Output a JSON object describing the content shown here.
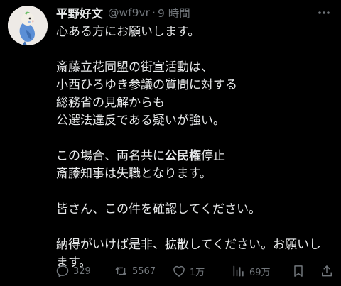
{
  "author": {
    "display_name": "平野好文",
    "handle": "@wf9vr",
    "separator": "·",
    "time_ago": "9 時間"
  },
  "tweet": {
    "lines": {
      "l0": "心ある方にお願いします。",
      "l1": "斎藤立花同盟の街宣活動は、",
      "l2": "小西ひろゆき参議の質問に対する",
      "l3": "総務省の見解からも",
      "l4": "公選法違反である疑いが強い。",
      "l5_pre": "この場合、両名共に",
      "l5_bold": "公民権",
      "l5_post": "停止",
      "l6": "斎藤知事は失職となります。",
      "l7": "皆さん、この件を確認してください。",
      "l8": "納得がいけば是非、拡散してください。お願いし",
      "l9": "ます。"
    }
  },
  "actions": {
    "reply_count": "329",
    "retweet_count": "5567",
    "like_count": "1万",
    "views_count": "69万"
  },
  "icons": {
    "avatar": "parakeet-avatar",
    "more": "more-icon",
    "reply": "reply-icon",
    "retweet": "retweet-icon",
    "like": "heart-icon",
    "views": "views-icon",
    "bookmark": "bookmark-icon",
    "share": "share-icon"
  },
  "colors": {
    "background": "#000000",
    "text": "#e7e9ea",
    "muted": "#71767b"
  }
}
